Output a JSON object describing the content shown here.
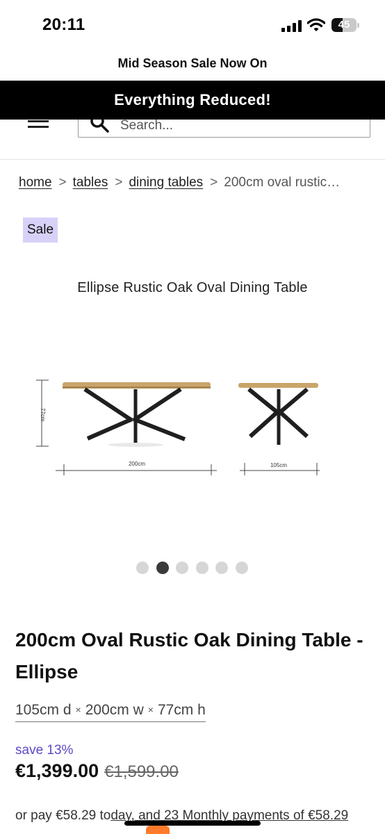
{
  "status_bar": {
    "time": "20:11",
    "battery": "45",
    "battery_level_percent": 45,
    "icons": [
      "signal-icon",
      "wifi-icon",
      "battery-icon"
    ]
  },
  "announcements": {
    "top": "Mid Season Sale Now On",
    "bar": "Everything Reduced!"
  },
  "header": {
    "search_placeholder": "Search..."
  },
  "breadcrumb": {
    "items": [
      "home",
      "tables",
      "dining tables"
    ],
    "separator": ">",
    "current": "200cm oval rustic…"
  },
  "badge": {
    "label": "Sale",
    "color": "#d7d1f8"
  },
  "gallery": {
    "title": "Ellipse Rustic Oak Oval Dining Table",
    "image_labels": {
      "height": "77cm",
      "length": "200cm",
      "width": "105cm"
    },
    "slide_count": 6,
    "active_slide": 2
  },
  "product": {
    "title": "200cm Oval Rustic Oak Dining Table - Ellipse",
    "dimensions": {
      "depth": "105cm d",
      "width": "200cm w",
      "height": "77cm h",
      "separator": "×"
    },
    "save": "save 13%",
    "price": "€1,399.00",
    "old_price": "€1,599.00",
    "installments": {
      "prefix": "or pay €58.29 to",
      "underlined": "day, and 23 Monthly p",
      "suffix": "ayments of €58.29"
    }
  },
  "colors": {
    "accent": "#5a49c6",
    "promo_bar": "#000000",
    "wood": "#c9a46b",
    "metal": "#1f1f1f"
  }
}
